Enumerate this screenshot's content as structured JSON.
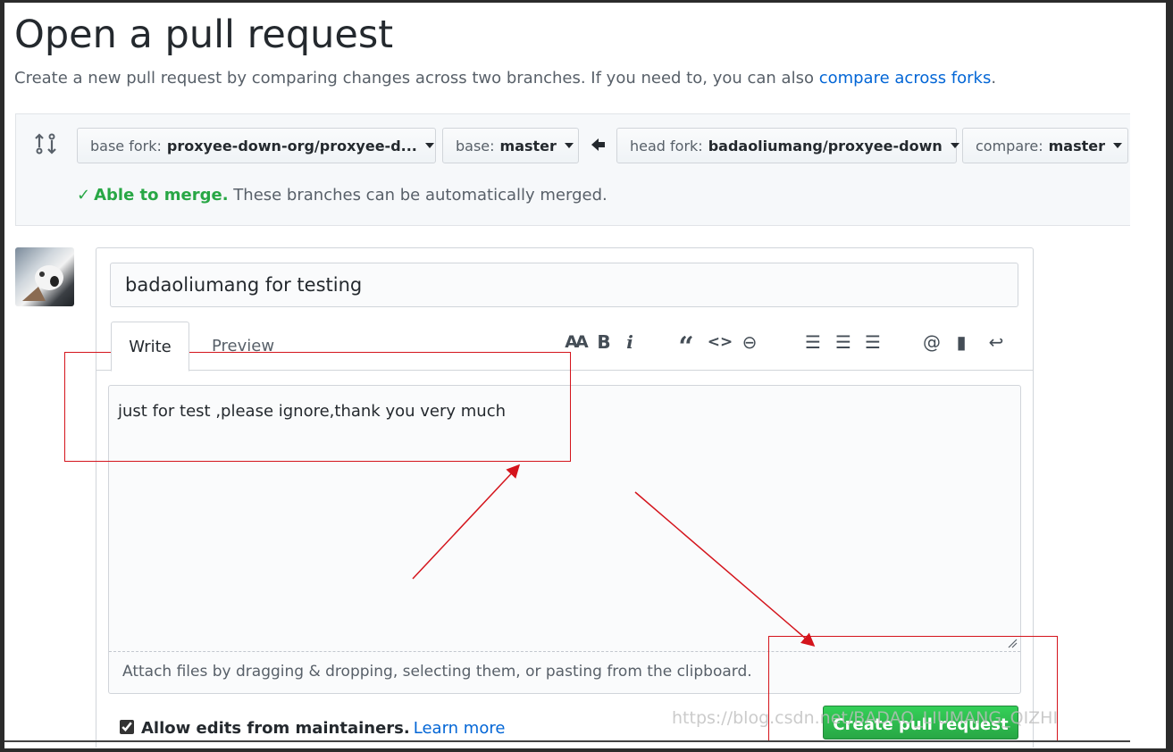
{
  "header": {
    "title": "Open a pull request",
    "subtitle": "Create a new pull request by comparing changes across two branches. If you need to, you can also ",
    "subtitle_link": "compare across forks",
    "subtitle_end": "."
  },
  "compare": {
    "base_fork_label": "base fork:",
    "base_fork_value": "proxyee-down-org/proxyee-d...",
    "base_label": "base:",
    "base_value": "master",
    "head_fork_label": "head fork:",
    "head_fork_value": "badaoliumang/proxyee-down",
    "compare_label": "compare:",
    "compare_value": "master",
    "merge_ok": "Able to merge.",
    "merge_msg": " These branches can be automatically merged."
  },
  "form": {
    "title_value": "badaoliumang for testing",
    "tabs": {
      "write": "Write",
      "preview": "Preview"
    },
    "toolbar": {
      "heading": "AA",
      "bold": "B",
      "italic": "i",
      "quote": "“",
      "code": "<>",
      "link": "⊖",
      "unordered_list": "☰",
      "ordered_list": "☰",
      "task_list": "☰",
      "mention": "@",
      "saved_reply": "▮",
      "reply": "↩"
    },
    "body_value": "just for test ,please ignore,thank you very much",
    "attach_text": "Attach files by dragging & dropping, selecting them, or pasting from the clipboard.",
    "allow_edits_label": "Allow edits from maintainers.",
    "learn_more": "Learn more",
    "allow_edits_checked": true,
    "create_button": "Create pull request"
  },
  "watermark": "https://blog.csdn.net/BADAO_LIUMANG_QIZHI",
  "colors": {
    "link": "#0366d6",
    "success": "#28a745",
    "annotation": "#d4141c"
  }
}
